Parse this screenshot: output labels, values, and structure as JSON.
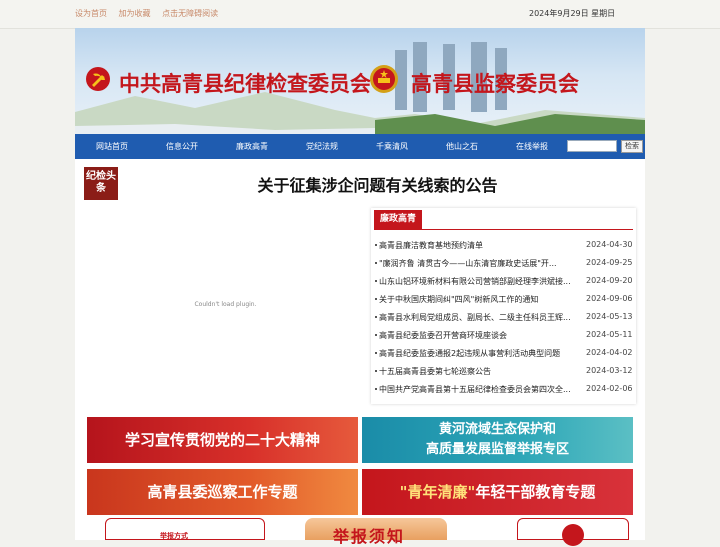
{
  "topbar": {
    "links": [
      "设为首页",
      "加为收藏",
      "点击无障碍阅读"
    ],
    "date": "2024年9月29日 星期日"
  },
  "banner": {
    "title_left": "中共高青县纪律检查委员会",
    "title_right": "高青县监察委员会"
  },
  "nav": {
    "items": [
      "网站首页",
      "信息公开",
      "廉政高青",
      "党纪法规",
      "千乘清风",
      "他山之石",
      "在线举报"
    ],
    "search_value": "",
    "search_button": "检索"
  },
  "badge": "纪检头条",
  "headline": "关于征集涉企问题有关线索的公告",
  "plugin": {
    "message": "Couldn't load plugin."
  },
  "news_panel": {
    "title": "廉政高青",
    "items": [
      {
        "title": "高青县廉洁教育基地预约清单",
        "date": "2024-04-30"
      },
      {
        "title": "\"廉润齐鲁 清贯古今——山东清官廉政史话展\"开...",
        "date": "2024-09-25"
      },
      {
        "title": "山东山铝环境新材料有限公司营销部副经理李洪斌接...",
        "date": "2024-09-20"
      },
      {
        "title": "关于中秋国庆期间纠\"四风\"树新风工作的通知",
        "date": "2024-09-06"
      },
      {
        "title": "高青县水利局党组成员、副局长、二级主任科员王辉...",
        "date": "2024-05-13"
      },
      {
        "title": "高青县纪委监委召开营商环境座谈会",
        "date": "2024-05-11"
      },
      {
        "title": "高青县纪委监委通报2起违规从事营利活动典型问题",
        "date": "2024-04-02"
      },
      {
        "title": "十五届高青县委第七轮巡察公告",
        "date": "2024-03-12"
      },
      {
        "title": "中国共产党高青县第十五届纪律检查委员会第四次全...",
        "date": "2024-02-06"
      }
    ]
  },
  "tiles": {
    "t1": "学习宣传贯彻党的二十大精神",
    "t2_line1": "黄河流域生态保护和",
    "t2_line2": "高质量发展监督举报专区",
    "t3": "高青县委巡察工作专题",
    "t4_quote": "\"青年清廉\"",
    "t4_rest": "年轻干部教育专题"
  },
  "bottom": {
    "report_method": "举报方式",
    "report_notice": "举报须知"
  },
  "colors": {
    "nav": "#1f5cb0",
    "accent_red": "#c4161c",
    "badge": "#8b1d17"
  }
}
